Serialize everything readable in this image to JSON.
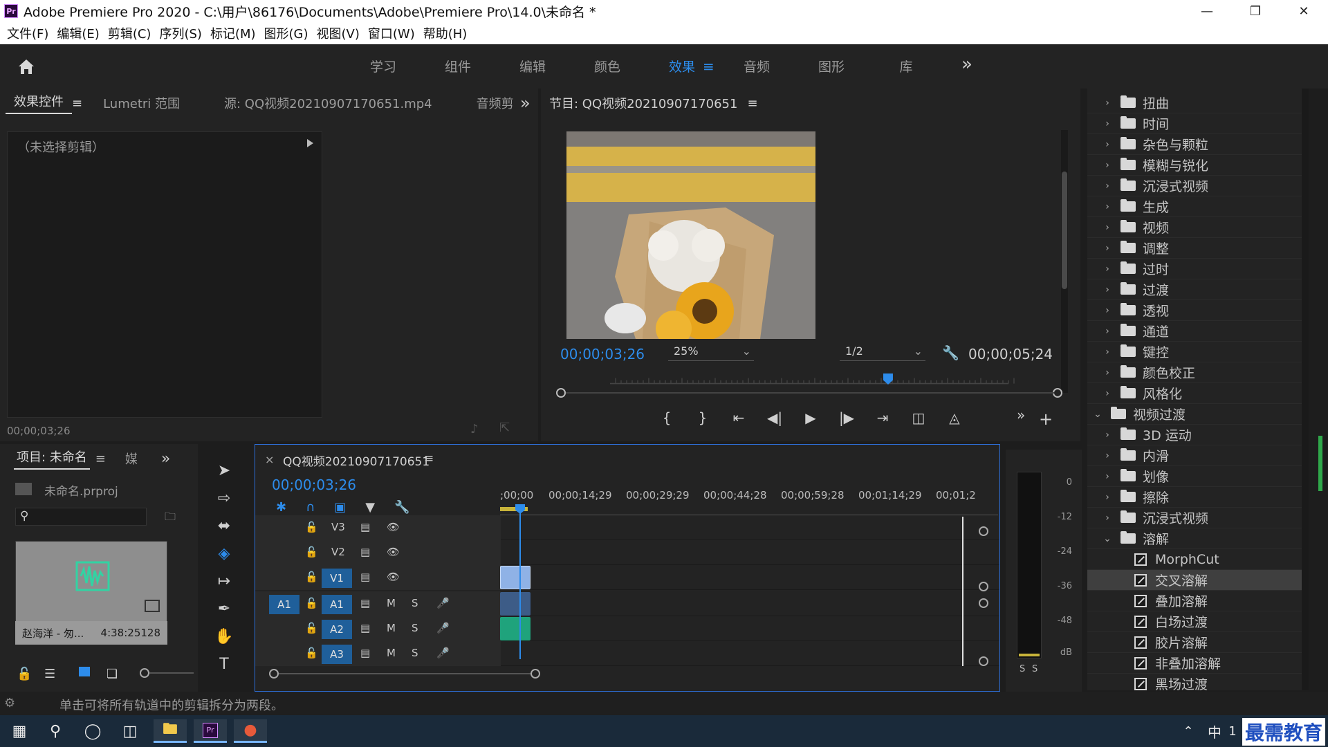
{
  "app": {
    "title": "Adobe Premiere Pro 2020 - C:\\用户\\86176\\Documents\\Adobe\\Premiere Pro\\14.0\\未命名 *",
    "logo": "Pr"
  },
  "menu": [
    "文件(F)",
    "编辑(E)",
    "剪辑(C)",
    "序列(S)",
    "标记(M)",
    "图形(G)",
    "视图(V)",
    "窗口(W)",
    "帮助(H)"
  ],
  "workspaces": [
    "学习",
    "组件",
    "编辑",
    "颜色",
    "效果",
    "音频",
    "图形",
    "库"
  ],
  "workspace_active": "效果",
  "source_panel": {
    "tabs": [
      "效果控件",
      "Lumetri 范围",
      "源: QQ视频20210907170651.mp4",
      "音频剪"
    ],
    "no_clip": "（未选择剪辑）",
    "timecode": "00;00;03;26"
  },
  "program_monitor": {
    "title": "节目: QQ视频20210907170651",
    "current_tc": "00;00;03;26",
    "zoom": "25%",
    "resolution": "1/2",
    "duration_tc": "00;00;05;24",
    "playhead_fraction": 0.66
  },
  "effects_tree": {
    "folders_top": [
      "扭曲",
      "时间",
      "杂色与颗粒",
      "模糊与锐化",
      "沉浸式视频",
      "生成",
      "视频",
      "调整",
      "过时",
      "过渡",
      "透视",
      "通道",
      "键控",
      "颜色校正",
      "风格化"
    ],
    "video_transitions_label": "视频过渡",
    "transition_folders": [
      "3D 运动",
      "内滑",
      "划像",
      "擦除",
      "沉浸式视频"
    ],
    "dissolve_label": "溶解",
    "dissolve_items": [
      "MorphCut",
      "交叉溶解",
      "叠加溶解",
      "白场过渡",
      "胶片溶解",
      "非叠加溶解",
      "黑场过渡"
    ],
    "selected_item": "交叉溶解"
  },
  "project_panel": {
    "tab": "项目: 未命名",
    "tab2": "媒",
    "file": "未命名.prproj",
    "clip_name": "赵海洋 - 匆...",
    "clip_duration": "4:38:25128"
  },
  "timeline": {
    "sequence_name": "QQ视频20210907170651",
    "timecode": "00;00;03;26",
    "ruler": [
      ";00;00",
      "00;00;14;29",
      "00;00;29;29",
      "00;00;44;28",
      "00;00;59;28",
      "00;01;14;29",
      "00;01;2"
    ],
    "video_tracks": [
      "V3",
      "V2",
      "V1"
    ],
    "audio_tracks": [
      "A1",
      "A2",
      "A3"
    ],
    "source_patch": "A1",
    "mute_label": "M",
    "solo_label": "S"
  },
  "meter": {
    "labels": [
      "0",
      "-12",
      "-24",
      "-36",
      "-48",
      "dB"
    ],
    "solo_labels": [
      "S",
      "S"
    ]
  },
  "status": {
    "message": "单击可将所有轨道中的剪辑拆分为两段。"
  },
  "taskbar": {
    "ime": "中",
    "clock_partial": "1",
    "watermark": "最需教育"
  }
}
